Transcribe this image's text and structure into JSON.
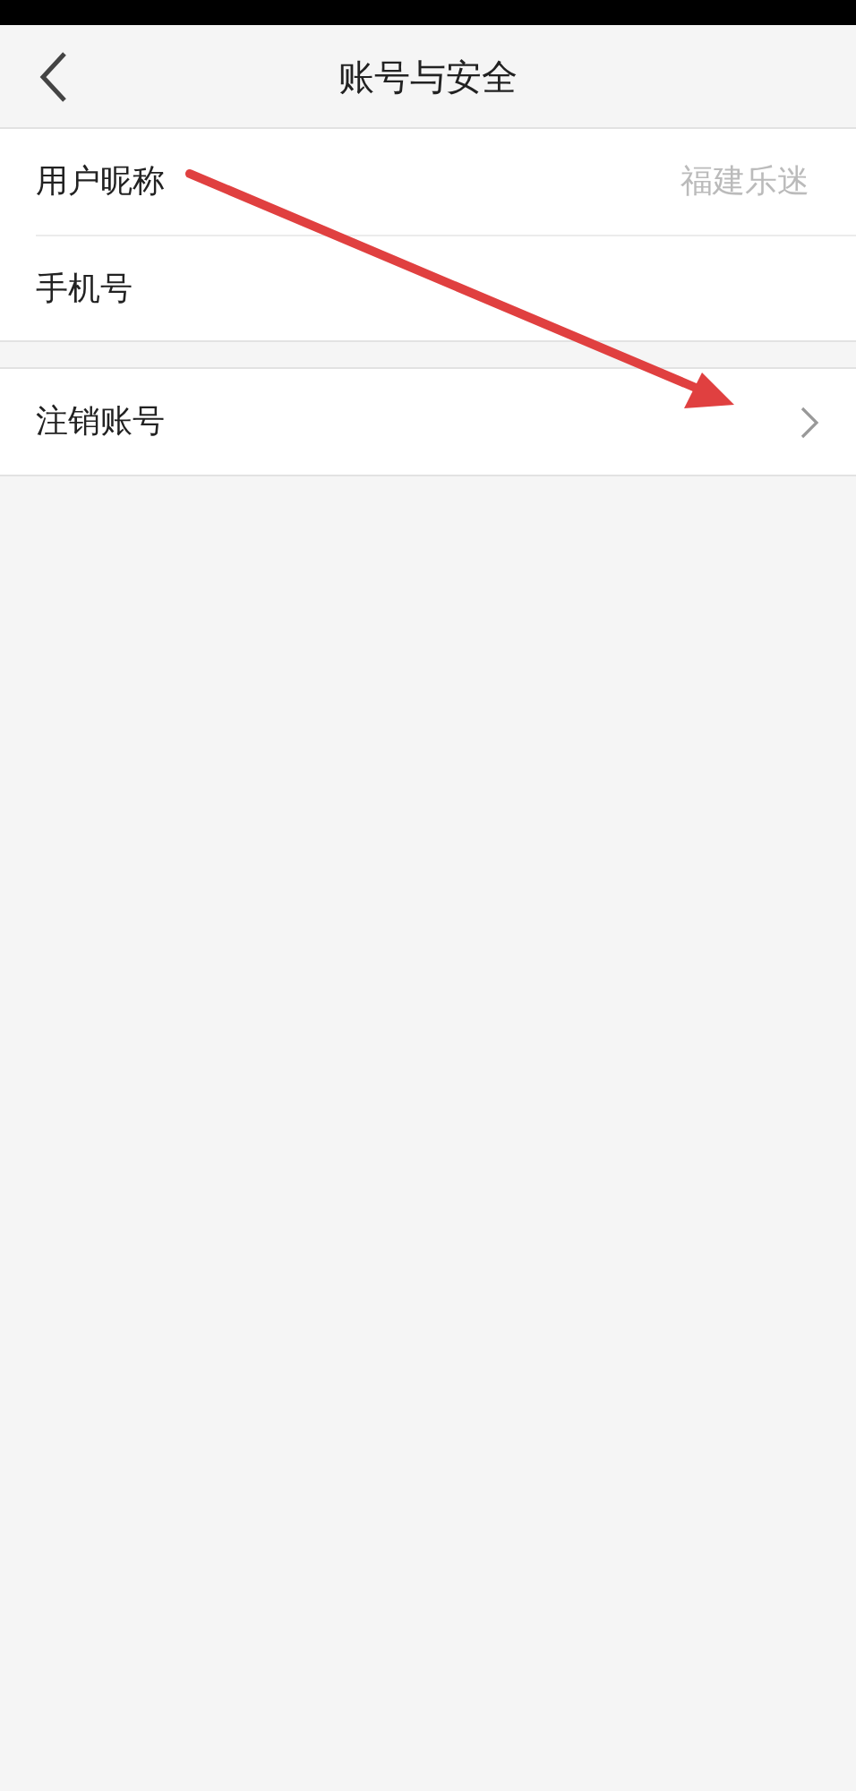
{
  "header": {
    "title": "账号与安全"
  },
  "groups": [
    {
      "rows": [
        {
          "kind": "value",
          "label": "用户昵称",
          "value": "福建乐迷"
        },
        {
          "kind": "plain",
          "label": "手机号"
        }
      ]
    },
    {
      "rows": [
        {
          "kind": "link",
          "label": "注销账号"
        }
      ]
    }
  ]
}
